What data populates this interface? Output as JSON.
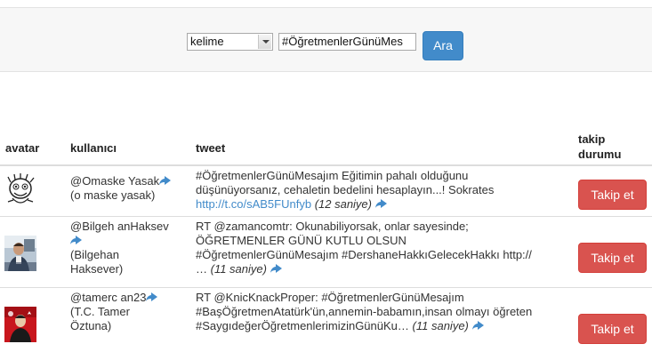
{
  "search": {
    "select_value": "kelime",
    "query_value": "#ÖğretmenlerGünüMes",
    "button_label": "Ara"
  },
  "table": {
    "headers": {
      "avatar": "avatar",
      "user": "kullanıcı",
      "tweet": "tweet",
      "follow_line1": "takip",
      "follow_line2": "durumu"
    },
    "rows": [
      {
        "handle": "@Omaske Yasak",
        "name": "(o maske yasak)",
        "tweet_line1": "#ÖğretmenlerGünüMesajım Eğitimin pahalı olduğunu",
        "tweet_line2": "düşünüyorsanız, cehaletin bedelini hesaplayın...! Sokrates",
        "tweet_link": "http://t.co/sAB5FUnfyb",
        "time": "(12 saniye)",
        "follow_label": "Takip et",
        "avatar_icon": "cartoon-mascot-avatar"
      },
      {
        "handle": "@Bilgeh anHaksev",
        "name_line1": "(Bilgehan",
        "name_line2": "Haksever)",
        "tweet_line1": "RT @zamancomtr: Okunabiliyorsak, onlar sayesinde;",
        "tweet_line2": "ÖĞRETMENLER GÜNÜ KUTLU OLSUN",
        "tweet_line3": "#ÖğretmenlerGünüMesajım #DershaneHakkıGelecekHakkı http://",
        "tweet_line4": "…",
        "time": "(11 saniye)",
        "follow_label": "Takip et",
        "avatar_icon": "person-photo-avatar"
      },
      {
        "handle": "@tamerc an23",
        "name_line1": "(T.C. Tamer",
        "name_line2": "Öztuna)",
        "tweet_line1": "RT @KnicKnackProper: #ÖğretmenlerGünüMesajım",
        "tweet_line2": "#BaşÖğretmenAtatürk'ün,annemin-babamın,insan olmayı öğreten",
        "tweet_line3": "#SaygıdeğerÖğretmenlerimizinGünüKu…",
        "time": "(11 saniye)",
        "follow_label": "Takip et",
        "avatar_icon": "red-flag-portrait-avatar"
      }
    ]
  },
  "colors": {
    "primary": "#428bca",
    "danger": "#d9534f",
    "link": "#428bca"
  }
}
